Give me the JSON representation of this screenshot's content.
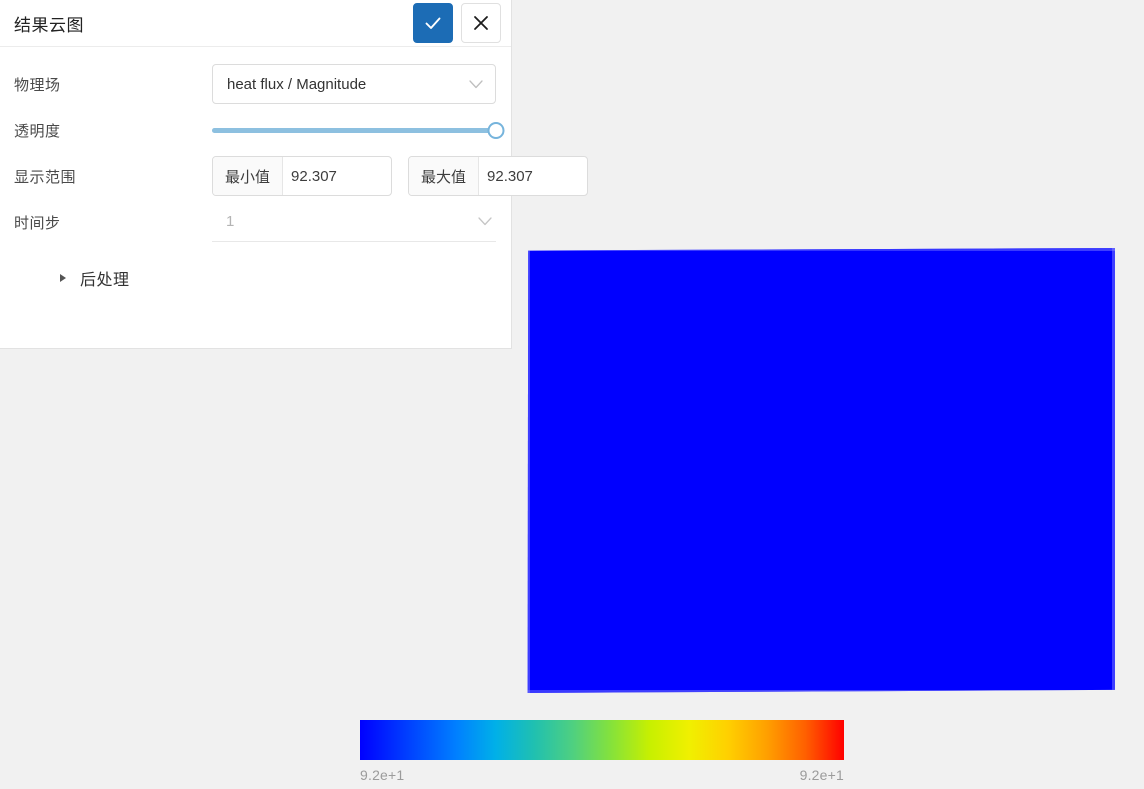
{
  "panel": {
    "title": "结果云图",
    "confirm_icon": "check-icon",
    "cancel_icon": "close-icon",
    "fields": {
      "physics_field": {
        "label": "物理场",
        "value": "heat flux / Magnitude",
        "icon": "chevron-down-icon"
      },
      "opacity": {
        "label": "透明度",
        "value": 100,
        "min": 0,
        "max": 100
      },
      "display_range": {
        "label": "显示范围",
        "min_addon": "最小值",
        "min_value": "92.307",
        "max_addon": "最大值",
        "max_value": "92.307"
      },
      "time_step": {
        "label": "时间步",
        "value": "1",
        "icon": "chevron-down-icon"
      }
    },
    "section": {
      "label": "后处理",
      "arrow_icon": "triangle-right-icon",
      "expanded": false
    }
  },
  "legend": {
    "min_label": "9.2e+1",
    "max_label": "9.2e+1",
    "colormap": "rainbow"
  },
  "viewport": {
    "geometry_name": "result-contour-quad",
    "fill_color": "#0000ff"
  },
  "colors": {
    "accent": "#1c6cb5",
    "background": "#f1f1f1",
    "panel": "#ffffff",
    "slider": "#8dc0e0"
  }
}
